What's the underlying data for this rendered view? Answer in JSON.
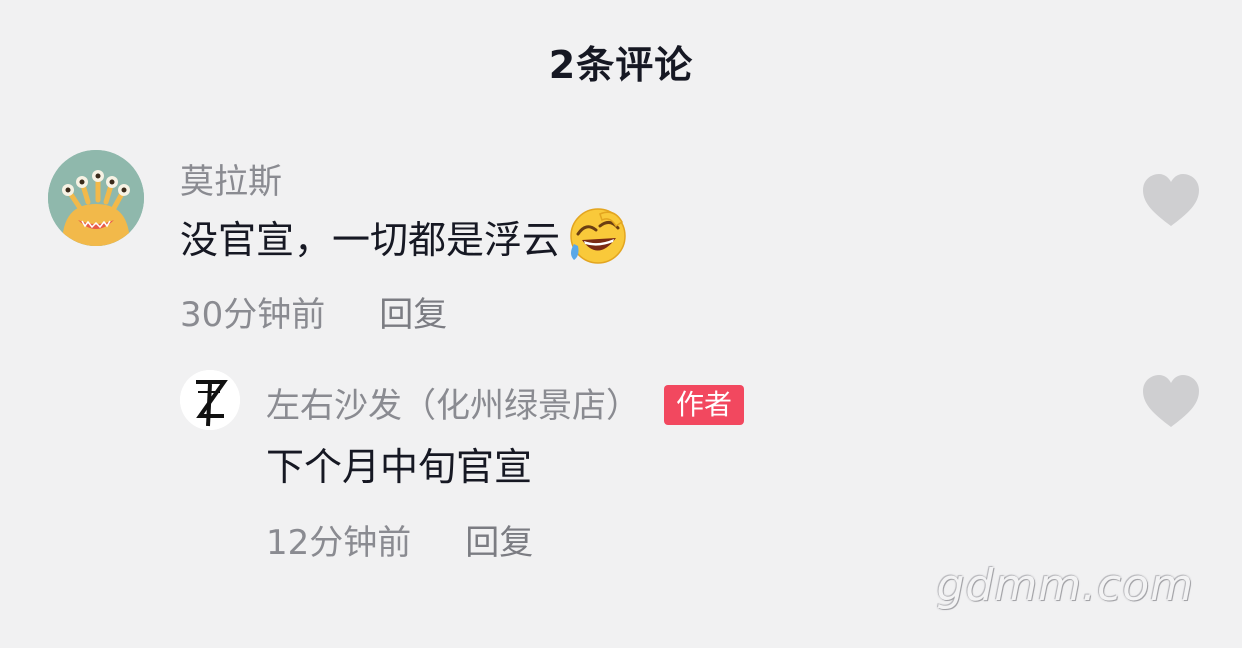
{
  "header": {
    "title": "2条评论"
  },
  "comments": [
    {
      "username": "莫拉斯",
      "text": "没官宣，一切都是浮云",
      "emoji": "laughing-crying-emoji",
      "time": "30分钟前",
      "reply_label": "回复",
      "replies": [
        {
          "username": "左右沙发（化州绿景店）",
          "badge": "作者",
          "text": "下个月中旬官宣",
          "time": "12分钟前",
          "reply_label": "回复"
        }
      ]
    }
  ],
  "icons": {
    "like": "heart-icon"
  },
  "colors": {
    "background": "#f1f1f2",
    "author_badge": "#f2485f",
    "heart": "#cfcfd1"
  },
  "watermark": "gdmm.com"
}
